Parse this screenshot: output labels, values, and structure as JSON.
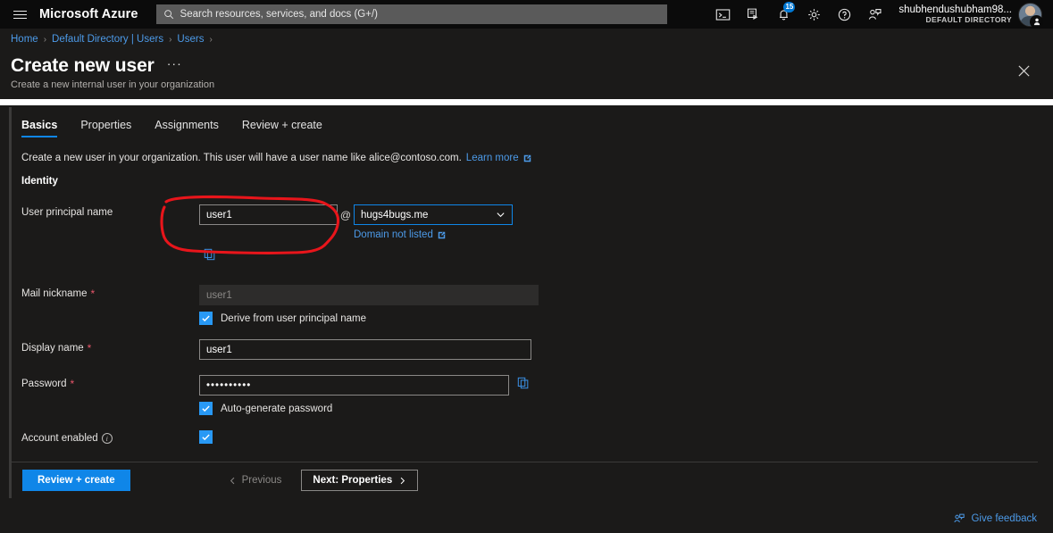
{
  "topbar": {
    "menu_icon": "hamburger-icon",
    "brand": "Microsoft Azure",
    "search_placeholder": "Search resources, services, and docs (G+/)",
    "icons": [
      {
        "name": "cloud-shell-icon",
        "label": "Cloud Shell"
      },
      {
        "name": "directories-subscriptions-icon",
        "label": "Directories + subscriptions"
      },
      {
        "name": "notifications-bell-icon",
        "label": "Notifications",
        "badge": "15"
      },
      {
        "name": "settings-gear-icon",
        "label": "Settings"
      },
      {
        "name": "help-question-icon",
        "label": "Help"
      },
      {
        "name": "feedback-icon",
        "label": "Feedback"
      }
    ],
    "account_name": "shubhendushubham98...",
    "account_directory": "DEFAULT DIRECTORY"
  },
  "breadcrumb": [
    "Home",
    "Default Directory | Users",
    "Users"
  ],
  "header": {
    "title": "Create new user",
    "more_label": "···",
    "subtitle": "Create a new internal user in your organization",
    "close_label": "✕"
  },
  "tabs": [
    {
      "label": "Basics",
      "active": true
    },
    {
      "label": "Properties",
      "active": false
    },
    {
      "label": "Assignments",
      "active": false
    },
    {
      "label": "Review + create",
      "active": false
    }
  ],
  "intro": {
    "text": "Create a new user in your organization. This user will have a user name like alice@contoso.com.",
    "link": "Learn more"
  },
  "section_identity": "Identity",
  "fields": {
    "upn": {
      "label": "User principal name",
      "value": "user1",
      "at_symbol": "@",
      "domain_value": "hugs4bugs.me",
      "domain_not_listed": "Domain not listed",
      "copy_icon": "copy-icon"
    },
    "mail_nickname": {
      "label": "Mail nickname",
      "required": "*",
      "value": "user1",
      "disabled": true,
      "checkbox_label": "Derive from user principal name",
      "checkbox_checked": true
    },
    "display_name": {
      "label": "Display name",
      "required": "*",
      "value": "user1"
    },
    "password": {
      "label": "Password",
      "required": "*",
      "value": "••••••••••",
      "copy_icon": "copy-icon",
      "checkbox_label": "Auto-generate password",
      "checkbox_checked": true
    },
    "account_enabled": {
      "label": "Account enabled",
      "info_icon": "info-icon",
      "checked": true
    }
  },
  "footer": {
    "review_create": "Review + create",
    "previous": "Previous",
    "next": "Next: Properties",
    "give_feedback": "Give feedback"
  },
  "colors": {
    "accent_blue": "#0f86e8",
    "link_blue": "#4c9ae8",
    "checkbox_blue": "#2899f5",
    "required_red": "#e9566b",
    "annotation_red": "#e8151b",
    "page_bg": "#1b1a19",
    "topbar_bg": "#0b0b0b"
  }
}
